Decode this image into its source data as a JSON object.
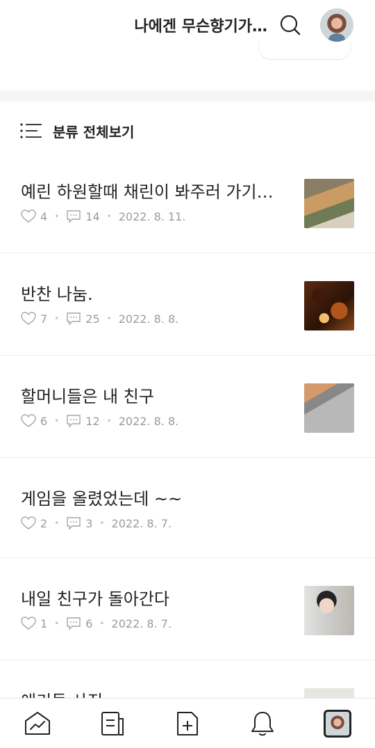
{
  "header": {
    "blog_title": "나에겐 무슨향기가…"
  },
  "category": {
    "label": "분류 전체보기"
  },
  "posts": [
    {
      "title": "예린 하원할때 채린이 봐주러 가기…",
      "likes": "4",
      "comments": "14",
      "date": "2022. 8. 11."
    },
    {
      "title": "반찬 나눔.",
      "likes": "7",
      "comments": "25",
      "date": "2022. 8. 8."
    },
    {
      "title": "할머니들은 내 친구",
      "likes": "6",
      "comments": "12",
      "date": "2022. 8. 8."
    },
    {
      "title": "게임을 올렸었는데 ~~",
      "likes": "2",
      "comments": "3",
      "date": "2022. 8. 7."
    },
    {
      "title": "내일 친구가 돌아간다",
      "likes": "1",
      "comments": "6",
      "date": "2022. 8. 7."
    },
    {
      "title": "애기들 사진"
    }
  ],
  "icons": {
    "search": "search-icon",
    "category": "list-icon",
    "like": "heart-icon",
    "comment": "comment-icon",
    "nav": [
      "trend-icon",
      "document-icon",
      "new-post-icon",
      "bell-icon",
      "profile-avatar"
    ]
  }
}
